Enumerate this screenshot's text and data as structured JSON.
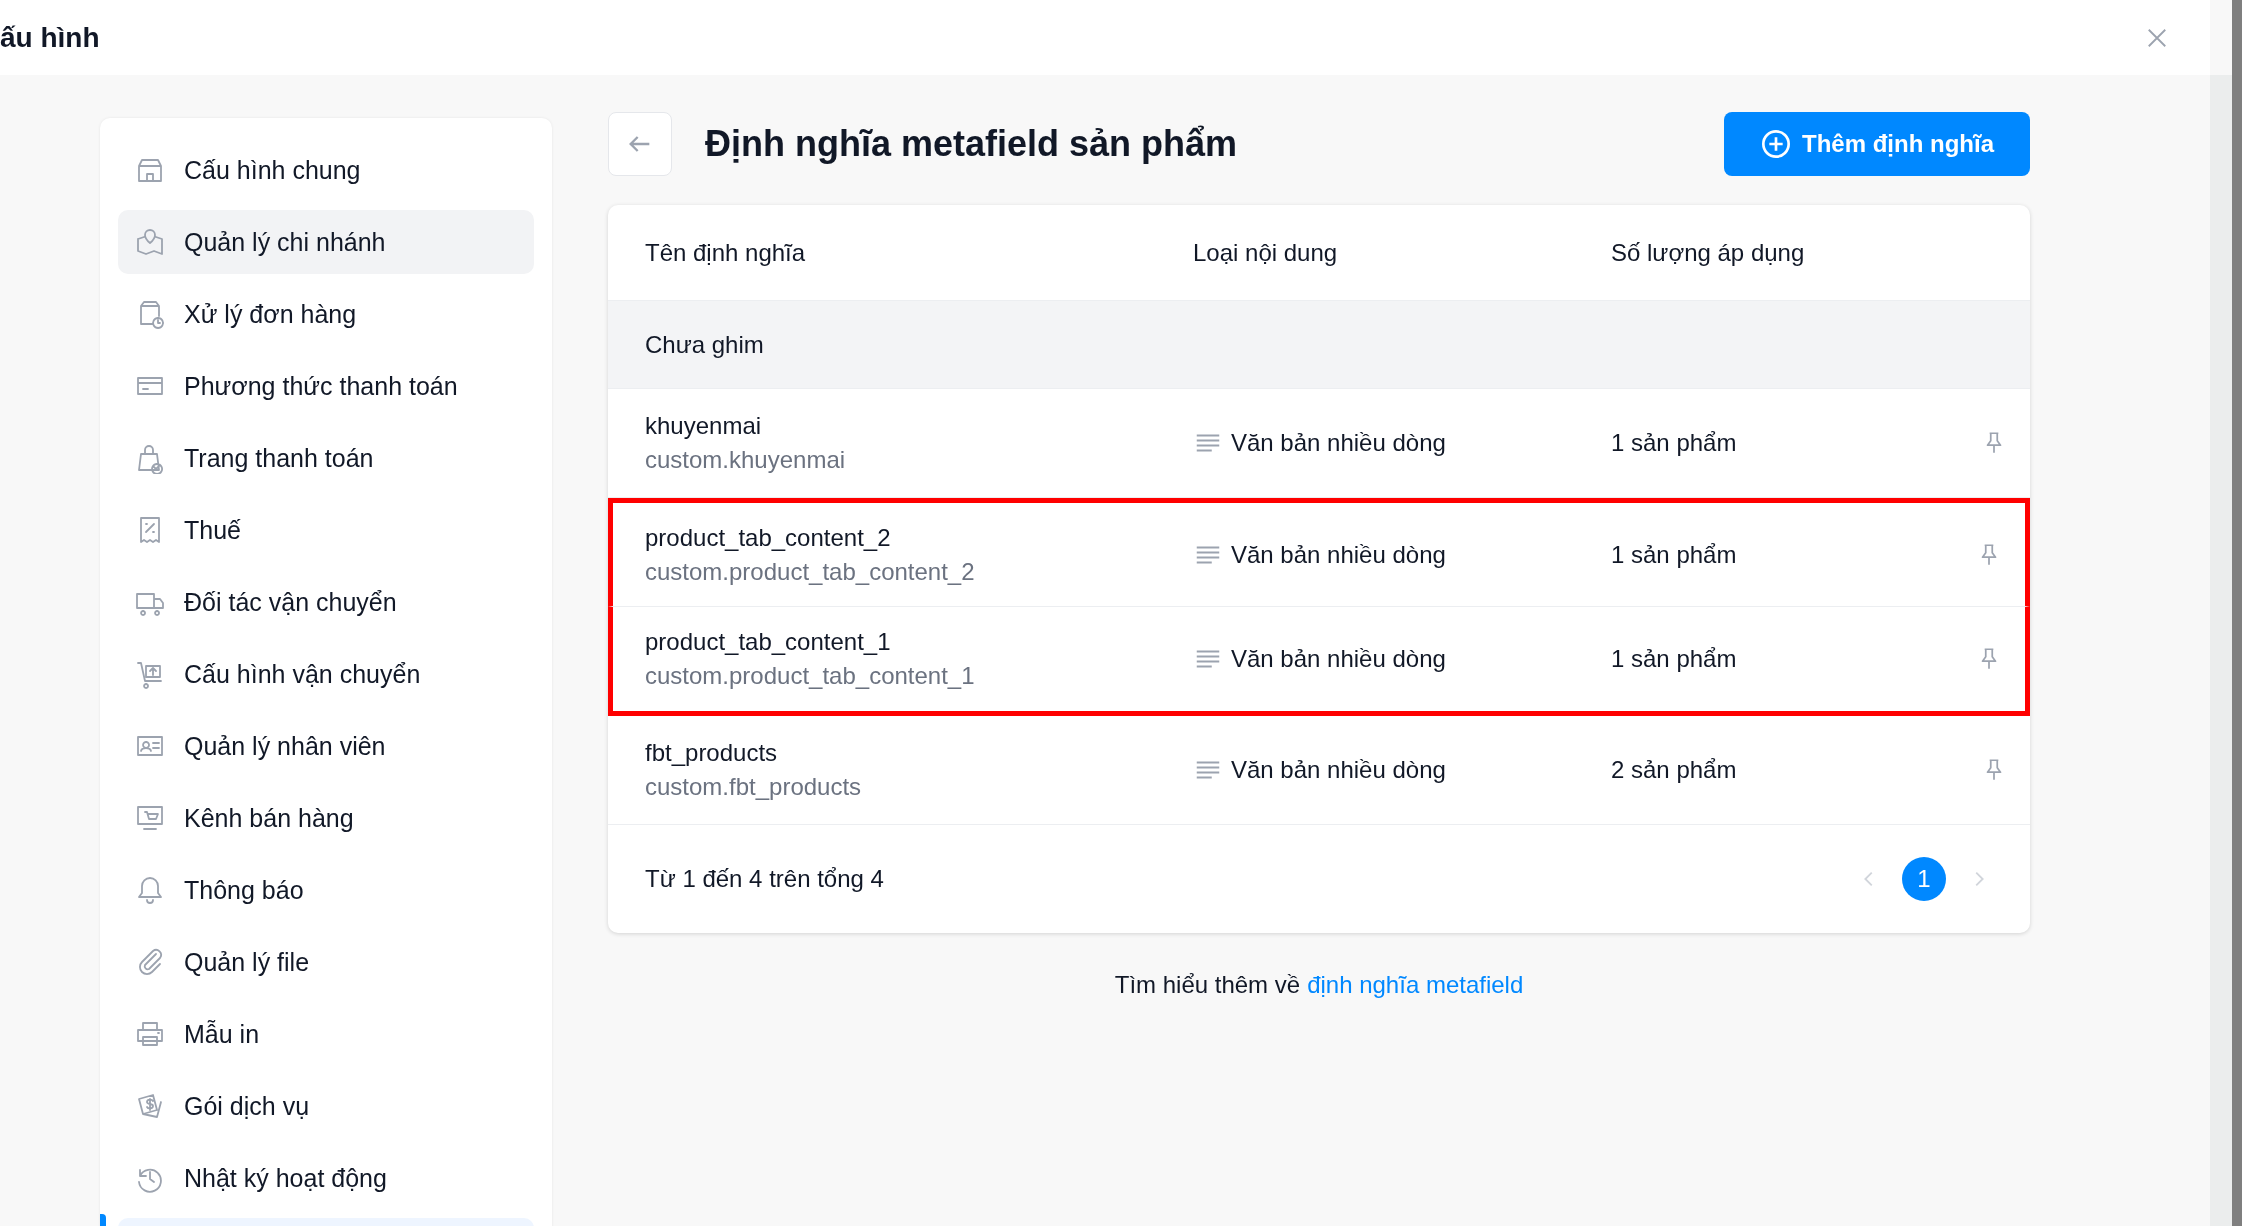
{
  "window": {
    "title": "ấu hình"
  },
  "sidebar": {
    "items": [
      {
        "label": "Cấu hình chung",
        "selected": false
      },
      {
        "label": "Quản lý chi nhánh",
        "selected": true
      },
      {
        "label": "Xử lý đơn hàng",
        "selected": false
      },
      {
        "label": "Phương thức thanh toán",
        "selected": false
      },
      {
        "label": "Trang thanh toán",
        "selected": false
      },
      {
        "label": "Thuế",
        "selected": false
      },
      {
        "label": "Đối tác vận chuyển",
        "selected": false
      },
      {
        "label": "Cấu hình vận chuyển",
        "selected": false
      },
      {
        "label": "Quản lý nhân viên",
        "selected": false
      },
      {
        "label": "Kênh bán hàng",
        "selected": false
      },
      {
        "label": "Thông báo",
        "selected": false
      },
      {
        "label": "Quản lý file",
        "selected": false
      },
      {
        "label": "Mẫu in",
        "selected": false
      },
      {
        "label": "Gói dịch vụ",
        "selected": false
      },
      {
        "label": "Nhật ký hoạt động",
        "selected": false
      }
    ]
  },
  "page": {
    "title": "Định nghĩa metafield sản phẩm",
    "add_button": "Thêm định nghĩa"
  },
  "table": {
    "columns": [
      "Tên định nghĩa",
      "Loại nội dung",
      "Số lượng áp dụng"
    ],
    "group": "Chưa ghim",
    "rows": [
      {
        "name": "khuyenmai",
        "key": "custom.khuyenmai",
        "type": "Văn bản nhiều dòng",
        "count": "1 sản phẩm",
        "pinned": false,
        "highlighted": false
      },
      {
        "name": "product_tab_content_2",
        "key": "custom.product_tab_content_2",
        "type": "Văn bản nhiều dòng",
        "count": "1 sản phẩm",
        "pinned": false,
        "highlighted": true
      },
      {
        "name": "product_tab_content_1",
        "key": "custom.product_tab_content_1",
        "type": "Văn bản nhiều dòng",
        "count": "1 sản phẩm",
        "pinned": false,
        "highlighted": true
      },
      {
        "name": "fbt_products",
        "key": "custom.fbt_products",
        "type": "Văn bản nhiều dòng",
        "count": "2 sản phẩm",
        "pinned": false,
        "highlighted": false
      }
    ],
    "summary": "Từ 1 đến 4 trên tổng 4",
    "pagination": {
      "prev_disabled": true,
      "next_disabled": true,
      "pages": [
        {
          "label": "1",
          "selected": true
        }
      ]
    }
  },
  "footer": {
    "text": "Tìm hiểu thêm về",
    "link": "định nghĩa metafield"
  }
}
